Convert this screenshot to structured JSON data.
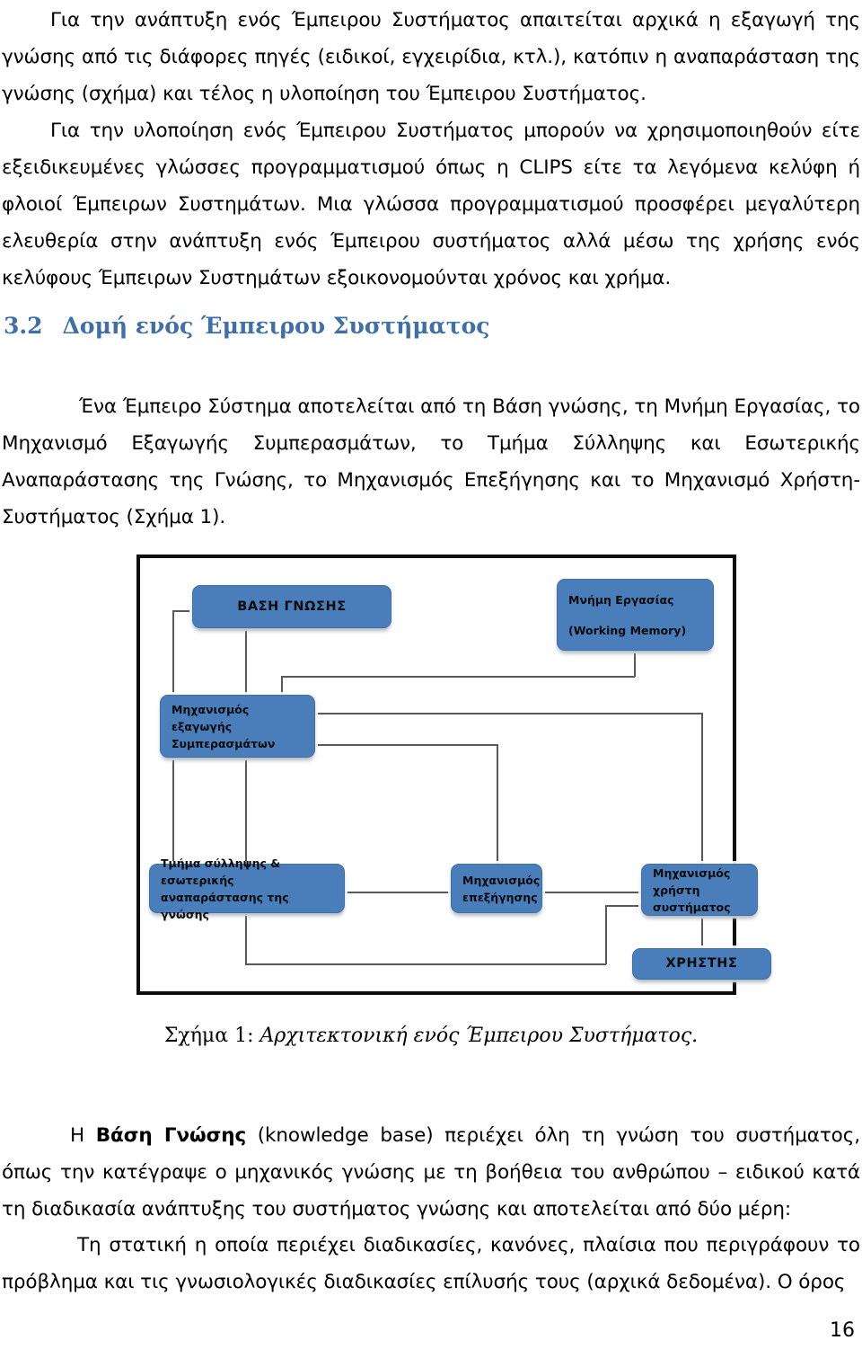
{
  "document": {
    "page_number": "16",
    "paragraphs": {
      "p1": "Για την ανάπτυξη ενός Έμπειρου Συστήματος απαιτείται αρχικά η εξαγωγή της γνώσης από τις διάφορες πηγές (ειδικοί, εγχειρίδια, κτλ.), κατόπιν η αναπαράσταση της γνώσης (σχήμα) και τέλος η υλοποίηση του Έμπειρου Συστήματος.",
      "p2": "Για την υλοποίηση ενός Έμπειρου Συστήματος μπορούν να χρησιμοποιηθούν είτε εξειδικευμένες γλώσσες προγραμματισμού όπως η CLIPS είτε τα λεγόμενα κελύφη ή φλοιοί Έμπειρων Συστημάτων. Μια γλώσσα προγραμματισμού προσφέρει μεγαλύτερη ελευθερία στην ανάπτυξη ενός Έμπειρου συστήματος αλλά μέσω της χρήσης ενός κελύφους Έμπειρων Συστημάτων εξοικονομούνται χρόνος και χρήμα.",
      "p3": "Ένα Έμπειρο Σύστημα αποτελείται από τη Βάση γνώσης, τη Μνήμη Εργασίας, το Μηχανισμό Εξαγωγής Συμπερασμάτων, το Τμήμα Σύλληψης και Εσωτερικής Αναπαράστασης της Γνώσης, το Μηχανισμός Επεξήγησης και το Μηχανισμό Χρήστη-Συστήματος (Σχήμα 1).",
      "p4_lead": "Η ",
      "p4_bold": "Βάση Γνώσης",
      "p4_rest": " (knowledge base) περιέχει όλη τη γνώση του συστήματος, όπως την κατέγραψε ο μηχανικός γνώσης με τη βοήθεια του ανθρώπου – ειδικού κατά τη διαδικασία ανάπτυξης του συστήματος γνώσης και αποτελείται από δύο μέρη:",
      "p5": "Τη στατική η οποία περιέχει διαδικασίες, κανόνες, πλαίσια που περιγράφουν το πρόβλημα και τις γνωσιολογικές διαδικασίες επίλυσής τους (αρχικά δεδομένα). Ο όρος"
    },
    "heading": {
      "number": "3.2",
      "text": "Δομή ενός Έμπειρου Συστήματος"
    },
    "figure": {
      "caption_label": "Σχήμα 1:",
      "caption_text": " Αρχιτεκτονική ενός Έμπειρου Συστήματος.",
      "accent_color": "#4a7ebb",
      "frame_color": "#0d0d0d",
      "connector_color": "#595959",
      "nodes": [
        {
          "id": "knowledge-base",
          "label": "ΒΑΣΗ ΓΝΩΣΗΣ"
        },
        {
          "id": "working-memory",
          "line1": "Μνήμη Εργασίας",
          "line2": "(Working Memory)"
        },
        {
          "id": "inference-engine",
          "line1": "Μηχανισμός εξαγωγής",
          "line2": "Συμπερασμάτων"
        },
        {
          "id": "knowledge-acquisition",
          "line1": "Τμήμα σύλληψης & εσωτερικής",
          "line2": "αναπαράστασης της γνώσης"
        },
        {
          "id": "explanation-facility",
          "line1": "Μηχανισμός",
          "line2": "επεξήγησης"
        },
        {
          "id": "user-interface",
          "line1": "Μηχανισμός χρήστη",
          "line2": "συστήματος"
        },
        {
          "id": "user",
          "label": "ΧΡΗΣΤΗΣ"
        }
      ]
    }
  }
}
